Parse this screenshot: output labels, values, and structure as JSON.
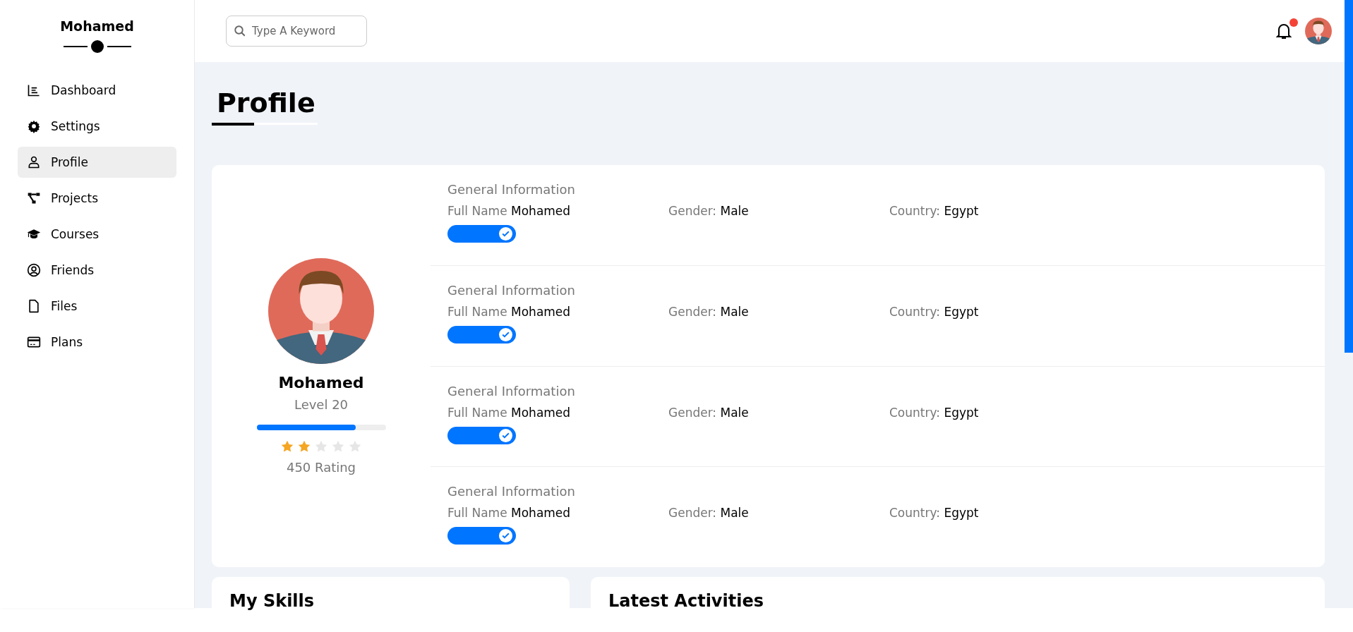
{
  "sidebar": {
    "title": "Mohamed",
    "items": [
      {
        "label": "Dashboard",
        "selected": false
      },
      {
        "label": "Settings",
        "selected": false
      },
      {
        "label": "Profile",
        "selected": true
      },
      {
        "label": "Projects",
        "selected": false
      },
      {
        "label": "Courses",
        "selected": false
      },
      {
        "label": "Friends",
        "selected": false
      },
      {
        "label": "Files",
        "selected": false
      },
      {
        "label": "Plans",
        "selected": false
      }
    ]
  },
  "header": {
    "search": {
      "placeholder": "Type A Keyword"
    },
    "notifications": {
      "unread": true
    }
  },
  "page_title": "Profile",
  "profile": {
    "name": "Mohamed",
    "level_text": "Level 20",
    "level": 0.77,
    "stars": 2,
    "rating": "450 Rating"
  },
  "info_sections": [
    {
      "title": "General Information",
      "fields": [
        {
          "label": "Full Name",
          "value": "Mohamed"
        },
        {
          "label": "Gender:",
          "value": "Male"
        },
        {
          "label": "Country:",
          "value": "Egypt"
        }
      ],
      "on": true
    },
    {
      "title": "General Information",
      "fields": [
        {
          "label": "Full Name",
          "value": "Mohamed"
        },
        {
          "label": "Gender:",
          "value": "Male"
        },
        {
          "label": "Country:",
          "value": "Egypt"
        }
      ],
      "on": true
    },
    {
      "title": "General Information",
      "fields": [
        {
          "label": "Full Name",
          "value": "Mohamed"
        },
        {
          "label": "Gender:",
          "value": "Male"
        },
        {
          "label": "Country:",
          "value": "Egypt"
        }
      ],
      "on": true
    },
    {
      "title": "General Information",
      "fields": [
        {
          "label": "Full Name",
          "value": "Mohamed"
        },
        {
          "label": "Gender:",
          "value": "Male"
        },
        {
          "label": "Country:",
          "value": "Egypt"
        }
      ],
      "on": true
    }
  ],
  "cards": [
    {
      "title": "My Skills"
    },
    {
      "title": "Latest Activities"
    }
  ]
}
